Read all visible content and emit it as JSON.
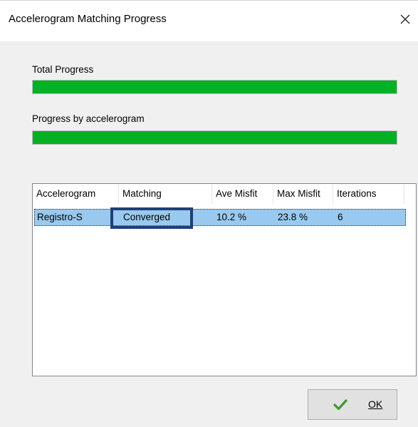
{
  "window": {
    "title": "Accelerogram Matching Progress"
  },
  "total_progress": {
    "label": "Total Progress",
    "value_percent": 100
  },
  "accelerogram_progress": {
    "label": "Progress by accelerogram",
    "value_percent": 100
  },
  "table": {
    "columns": [
      "Accelerogram",
      "Matching",
      "Ave Misfit",
      "Max Misfit",
      "Iterations"
    ],
    "rows": [
      [
        "Registro-S",
        "Converged",
        "10.2 %",
        "23.8 %",
        "6"
      ]
    ]
  },
  "ok_button": {
    "label": "OK",
    "icon": "checkmark-icon"
  },
  "colors": {
    "progress_fill": "#06b025",
    "selected_row": "#99c9ef",
    "highlight_box": "#1f3f75"
  }
}
